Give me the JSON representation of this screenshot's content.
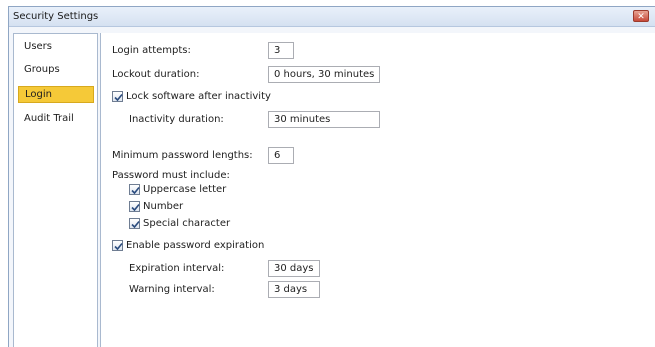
{
  "window": {
    "title": "Security Settings",
    "close_glyph": "✕"
  },
  "nav": {
    "items": [
      {
        "label": "Users",
        "selected": false
      },
      {
        "label": "Groups",
        "selected": false
      },
      {
        "label": "Login",
        "selected": true
      },
      {
        "label": "Audit Trail",
        "selected": false
      }
    ]
  },
  "login": {
    "attempts_label": "Login attempts:",
    "attempts_value": "3",
    "lockout_label": "Lockout duration:",
    "lockout_value": "0 hours, 30 minutes",
    "lock_inactivity_label": "Lock software after inactivity",
    "lock_inactivity_checked": true,
    "inactivity_label": "Inactivity duration:",
    "inactivity_value": "30 minutes",
    "min_length_label": "Minimum password lengths:",
    "min_length_value": "6",
    "must_include_label": "Password must include:",
    "uppercase_label": "Uppercase letter",
    "uppercase_checked": true,
    "number_label": "Number",
    "number_checked": true,
    "special_label": "Special character",
    "special_checked": true,
    "expiration_label": "Enable password expiration",
    "expiration_checked": true,
    "expiration_interval_label": "Expiration interval:",
    "expiration_interval_value": "30 days",
    "warning_interval_label": "Warning interval:",
    "warning_interval_value": "3 days"
  },
  "colors": {
    "selected_nav": "#f5c938",
    "close_button": "#c74a3a",
    "title_bar": "#dce6f4"
  }
}
